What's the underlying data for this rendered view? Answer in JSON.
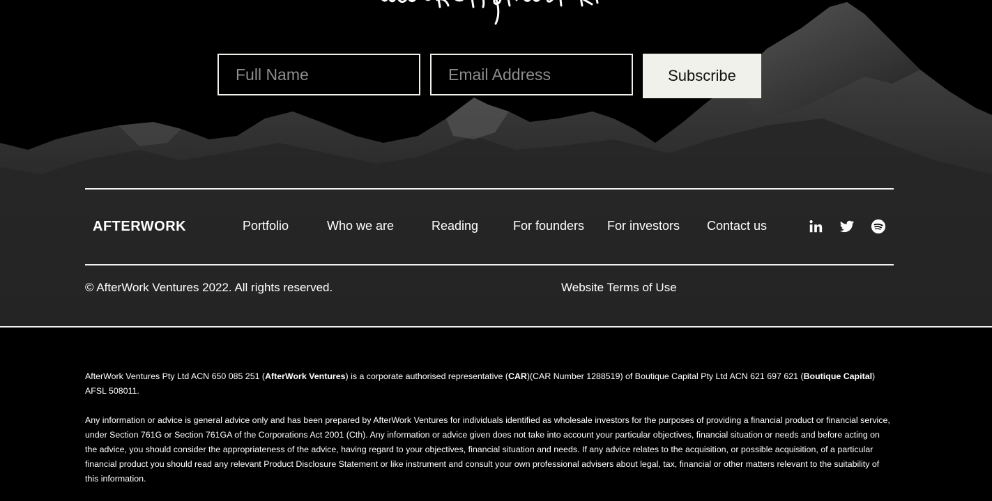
{
  "newsletter": {
    "script_heading": "make it afterwork",
    "name_placeholder": "Full Name",
    "email_placeholder": "Email Address",
    "subscribe_label": "Subscribe"
  },
  "footer": {
    "logo_text": "AFTERWORK",
    "nav": [
      {
        "label": "Portfolio"
      },
      {
        "label": "Who we are"
      },
      {
        "label": "Reading"
      },
      {
        "label": "For founders"
      },
      {
        "label": "For investors"
      },
      {
        "label": "Contact us"
      }
    ],
    "social": [
      "linkedin-icon",
      "twitter-icon",
      "spotify-icon"
    ],
    "copyright": "© AfterWork Ventures 2022. All rights reserved.",
    "terms_link": "Website Terms of Use"
  },
  "legal": {
    "p1": {
      "a": "AfterWork Ventures Pty Ltd ACN 650 085 251 (",
      "b": "AfterWork Ventures",
      "c": ") is a corporate authorised representative (",
      "d": "CAR",
      "e": ")(CAR Number 1288519) of Boutique Capital Pty Ltd ACN 621 697 621 (",
      "f": "Boutique Capital",
      "g": ") AFSL 508011."
    },
    "p2": "Any information or advice is general advice only and has been prepared by AfterWork Ventures for individuals identified as wholesale investors for the purposes of providing a financial product or financial service, under Section 761G or Section 761GA of the Corporations Act 2001 (Cth). Any information or advice given does not take into account your particular objectives, financial situation or needs and before acting on the advice, you should consider the appropriateness of the advice, having regard to your objectives, financial situation and needs. If any advice relates to the acquisition, or possible acquisition, of a particular financial product you should read any relevant Product Disclosure Statement or like instrument and consult your own professional advisers about legal, tax, financial or other matters relevant to the suitability of this information."
  },
  "colors": {
    "background": "#000000",
    "button_bg": "#f0f1eb",
    "text": "#ffffff",
    "placeholder": "#8d8d8d"
  }
}
